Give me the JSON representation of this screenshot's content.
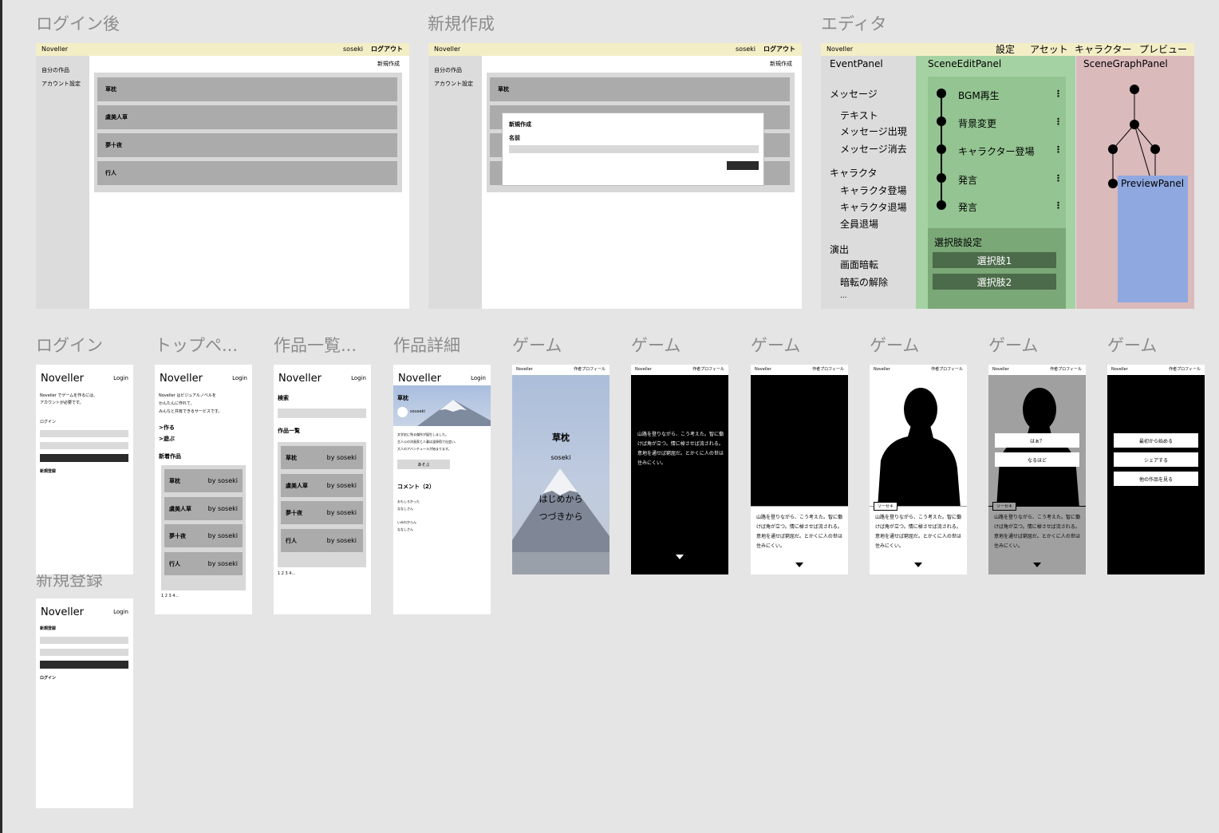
{
  "titles": {
    "after_login": "ログイン後",
    "new_create": "新規作成",
    "editor": "エディタ",
    "login": "ログイン",
    "top": "トップペ...",
    "works": "作品一覧...",
    "detail": "作品詳細",
    "game1": "ゲーム",
    "game2": "ゲーム",
    "game3": "ゲーム",
    "game4": "ゲーム",
    "game5": "ゲーム",
    "game6": "ゲーム",
    "signup": "新規登録"
  },
  "desk": {
    "brand": "Noveller",
    "user": "soseki",
    "logout": "ログアウト",
    "new_button": "新規作成",
    "side": [
      "自分の作品",
      "アカウント設定"
    ],
    "works": [
      "草枕",
      "虞美人草",
      "夢十夜",
      "行人"
    ],
    "modal": {
      "title": "新規作成",
      "label": "名前"
    }
  },
  "editor": {
    "brand": "Noveller",
    "menu": [
      "設定",
      "アセット",
      "キャラクター",
      "プレビュー"
    ],
    "event_panel": "EventPanel",
    "scene_edit_panel": "SceneEditPanel",
    "scene_graph_panel": "SceneGraphPanel",
    "preview_panel": "PreviewPanel",
    "groups": [
      {
        "h": "メッセージ",
        "items": [
          "テキスト",
          "メッセージ出現",
          "メッセージ消去"
        ]
      },
      {
        "h": "キャラクタ",
        "items": [
          "キャラクタ登場",
          "キャラクタ退場",
          "全員退場"
        ]
      },
      {
        "h": "演出",
        "items": [
          "画面暗転",
          "暗転の解除",
          "..."
        ]
      }
    ],
    "scene_items": [
      "BGM再生",
      "背景変更",
      "キャラクター登場",
      "発言",
      "発言"
    ],
    "choice_title": "選択肢設定",
    "choices": [
      "選択肢1",
      "選択肢2"
    ]
  },
  "mobile": {
    "brand": "Noveller",
    "login": "Login",
    "login_page": {
      "desc1": "Noveller でゲームを作るには、",
      "desc2": "アカウントが必要です。",
      "label": "ログイン",
      "link": "新規登録"
    },
    "signup_page": {
      "label": "新規登録",
      "link": "ログイン"
    },
    "top_page": {
      "desc1": "Noveller はビジュアルノベルを",
      "desc2": "かんたんに作れて、",
      "desc3": "みんなと共有できるサービスです。",
      "make": ">作る",
      "play": ">遊ぶ",
      "new_works": "新着作品",
      "pager": "1 2 3 4..."
    },
    "works_page": {
      "search": "検索",
      "list": "作品一覧",
      "pager": "1 2 3 4..."
    },
    "by": "by soseki",
    "detail_page": {
      "title": "草枕",
      "author": "sousekI",
      "desc1": "文学史に残る傑作が誕生しました。",
      "desc2": "主人公の洋画家と人妻は温泉宿で出会い、",
      "desc3": "大人のアバンチュールが始まります。",
      "play": "あそぶ",
      "comments": "コメント（2）",
      "c1": "おもしろかった",
      "u1": "ななしさん",
      "c2": "いみわからん",
      "u2": "ななしさん"
    }
  },
  "game": {
    "brand": "Noveller",
    "profile": "作者プロフィール",
    "title": "草枕",
    "author": "soseki",
    "start": "はじめから",
    "continue": "つづきから",
    "text1": "山路を登りながら、こう考えた。智に働けば角が立つ。情に棹させば流される。意地を通せば窮屈だ。とかくに人の世は住みにくい。",
    "name": "ソーセキ",
    "choice1": "はぁ？",
    "choice2": "なるほど",
    "end1": "最初から始める",
    "end2": "シェアする",
    "end3": "他の作品を見る"
  }
}
